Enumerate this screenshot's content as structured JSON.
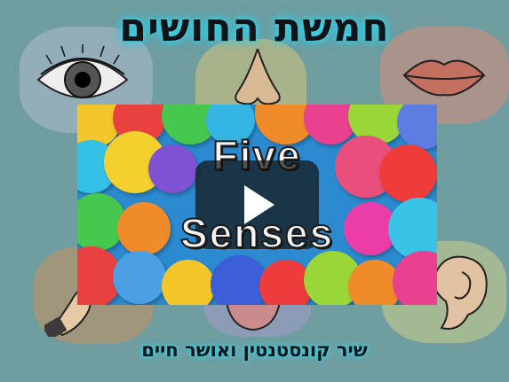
{
  "title_hebrew": "חמשת החושים",
  "credit_hebrew": "שיר קונסטנטין ואושר חיים",
  "video": {
    "title_line1": "Five",
    "title_line2": "Senses",
    "play_icon": "play-icon"
  }
}
